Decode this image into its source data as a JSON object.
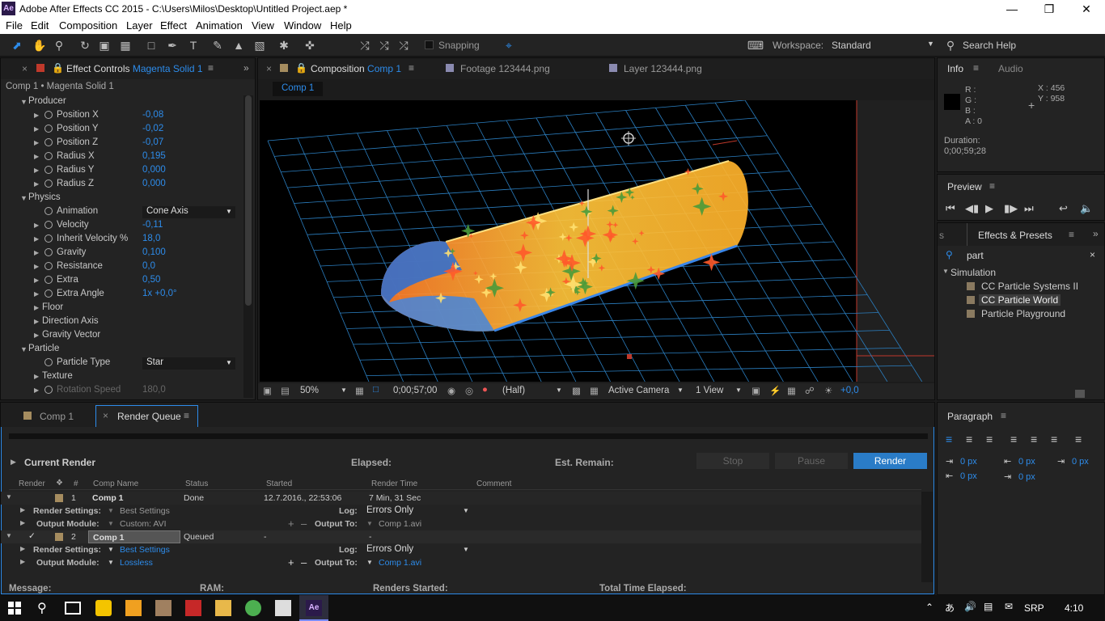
{
  "window": {
    "title": "Adobe After Effects CC 2015 - C:\\Users\\Milos\\Desktop\\Untitled Project.aep *",
    "app_icon": "Ae"
  },
  "menu": [
    "File",
    "Edit",
    "Composition",
    "Layer",
    "Effect",
    "Animation",
    "View",
    "Window",
    "Help"
  ],
  "toolbar": {
    "snapping": "Snapping",
    "workspace_label": "Workspace:",
    "workspace_value": "Standard",
    "search_help": "Search Help"
  },
  "effect_controls": {
    "tab_label": "Effect Controls",
    "tab_layer": "Magenta Solid 1",
    "breadcrumb": "Comp 1 • Magenta Solid 1",
    "rows": [
      {
        "kind": "group",
        "label": "Producer"
      },
      {
        "kind": "prop",
        "label": "Position X",
        "value": "-0,08"
      },
      {
        "kind": "prop",
        "label": "Position Y",
        "value": "-0,02"
      },
      {
        "kind": "prop",
        "label": "Position Z",
        "value": "-0,07"
      },
      {
        "kind": "prop",
        "label": "Radius X",
        "value": "0,195"
      },
      {
        "kind": "prop",
        "label": "Radius Y",
        "value": "0,000"
      },
      {
        "kind": "prop",
        "label": "Radius Z",
        "value": "0,000"
      },
      {
        "kind": "group",
        "label": "Physics"
      },
      {
        "kind": "dropdown",
        "label": "Animation",
        "value": "Cone Axis"
      },
      {
        "kind": "prop",
        "label": "Velocity",
        "value": "-0,11"
      },
      {
        "kind": "prop",
        "label": "Inherit Velocity %",
        "value": "18,0"
      },
      {
        "kind": "prop",
        "label": "Gravity",
        "value": "0,100"
      },
      {
        "kind": "prop",
        "label": "Resistance",
        "value": "0,0"
      },
      {
        "kind": "prop",
        "label": "Extra",
        "value": "0,50"
      },
      {
        "kind": "prop",
        "label": "Extra Angle",
        "value": "1x +0,0°"
      },
      {
        "kind": "sub",
        "label": "Floor"
      },
      {
        "kind": "sub",
        "label": "Direction Axis"
      },
      {
        "kind": "sub",
        "label": "Gravity Vector"
      },
      {
        "kind": "group",
        "label": "Particle"
      },
      {
        "kind": "dropdown",
        "label": "Particle Type",
        "value": "Star"
      },
      {
        "kind": "sub",
        "label": "Texture"
      },
      {
        "kind": "dim",
        "label": "Rotation Speed",
        "value": "180,0"
      }
    ]
  },
  "composition": {
    "tab_label": "Composition",
    "tab_comp": "Comp 1",
    "footage_tab": "Footage 123444.png",
    "layer_tab": "Layer 123444.png",
    "comp_chip": "Comp 1",
    "footer": {
      "zoom": "50%",
      "timecode": "0;00;57;00",
      "resolution": "(Half)",
      "camera": "Active Camera",
      "views": "1 View",
      "exposure": "+0,0"
    }
  },
  "info": {
    "tab": "Info",
    "audio_tab": "Audio",
    "r": "R :",
    "g": "G :",
    "b": "B :",
    "a": "A : 0",
    "x": "X : 456",
    "y": "Y : 958",
    "duration_label": "Duration:",
    "duration": "0;00;59;28"
  },
  "preview": {
    "title": "Preview"
  },
  "effects_presets": {
    "title": "Effects & Presets",
    "search": "part",
    "category": "Simulation",
    "items": [
      "CC Particle Systems II",
      "CC Particle World",
      "Particle Playground"
    ],
    "selected": 1
  },
  "paragraph": {
    "title": "Paragraph",
    "indent_values": [
      "0 px",
      "0 px",
      "0 px",
      "0 px",
      "0 px"
    ]
  },
  "bottom_tabs": {
    "comp": "Comp 1",
    "render_queue": "Render Queue"
  },
  "render_queue": {
    "current_render": "Current Render",
    "elapsed": "Elapsed:",
    "est_remain": "Est. Remain:",
    "stop": "Stop",
    "pause": "Pause",
    "render": "Render",
    "columns": [
      "Render",
      "#",
      "Comp Name",
      "Status",
      "Started",
      "Render Time",
      "Comment"
    ],
    "items": [
      {
        "num": "1",
        "comp": "Comp 1",
        "status": "Done",
        "started": "12.7.2016., 22:53:06",
        "render_time": "7 Min, 31 Sec",
        "render_settings": "Best Settings",
        "output_module": "Custom: AVI",
        "log": "Errors Only",
        "output_to": "Comp 1.avi",
        "checked": false
      },
      {
        "num": "2",
        "comp": "Comp 1",
        "status": "Queued",
        "started": "-",
        "render_time": "-",
        "render_settings": "Best Settings",
        "output_module": "Lossless",
        "log": "Errors Only",
        "output_to": "Comp 1.avi",
        "checked": true
      }
    ],
    "labels": {
      "render_settings": "Render Settings:",
      "output_module": "Output Module:",
      "log": "Log:",
      "output_to": "Output To:"
    },
    "footer": {
      "message": "Message:",
      "ram": "RAM:",
      "renders_started": "Renders Started:",
      "total_time": "Total Time Elapsed:"
    }
  },
  "taskbar": {
    "lang": "SRP",
    "time": "4:10"
  },
  "colors": {
    "accent": "#2d8ceb",
    "render_button": "#2a7cc7",
    "comp_border": "#c0392b",
    "grid": "#2b7fc1"
  }
}
